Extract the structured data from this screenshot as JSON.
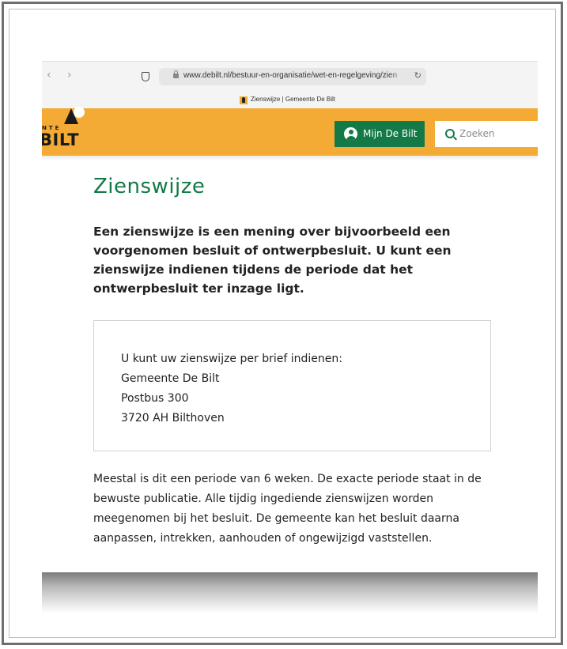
{
  "browser": {
    "back_glyph": "‹",
    "forward_glyph": "›",
    "url": "www.debilt.nl/bestuur-en-organisatie/wet-en-regelgeving/zien",
    "reload_glyph": "↻",
    "tab_title": "Zienswijze | Gemeente De Bilt"
  },
  "header": {
    "logo_small": "NTE",
    "logo_text": "BILT",
    "mijn_label": "Mijn De Bilt",
    "search_placeholder": "Zoeken",
    "brand_color": "#f4ab35",
    "accent_color": "#137a47"
  },
  "content": {
    "title": "Zienswijze",
    "intro": "Een zienswijze is een mening over bijvoorbeeld een voorgenomen besluit of ontwerpbesluit. U kunt een zienswijze indienen tijdens de periode dat het ontwerpbesluit ter inzage ligt.",
    "box": {
      "line1": "U kunt uw zienswijze per brief indienen:",
      "line2": "Gemeente De Bilt",
      "line3": "Postbus 300",
      "line4": "3720 AH Bilthoven"
    },
    "outro": "Meestal is dit een periode van 6 weken. De exacte periode staat in de bewuste publicatie. Alle tijdig ingediende zienswijzen worden meegenomen bij het besluit. De gemeente kan het besluit daarna aanpassen, intrekken, aanhouden of ongewijzigd vaststellen."
  }
}
